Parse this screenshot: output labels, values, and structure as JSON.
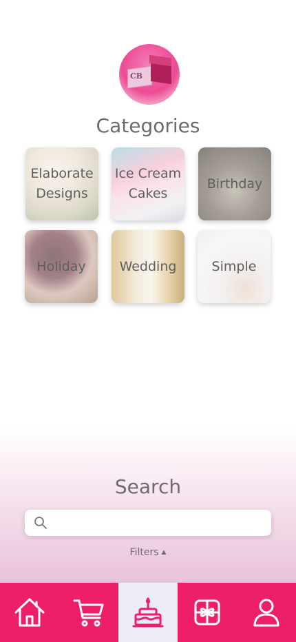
{
  "header": {
    "logo_text": "CB",
    "title": "Categories"
  },
  "categories": [
    {
      "label": "Elaborate Designs"
    },
    {
      "label": "Ice Cream Cakes"
    },
    {
      "label": "Birthday"
    },
    {
      "label": "Holiday"
    },
    {
      "label": "Wedding"
    },
    {
      "label": "Simple"
    }
  ],
  "search": {
    "title": "Search",
    "value": "",
    "placeholder": "",
    "filters_label": "Filters",
    "filters_caret": "▲"
  },
  "nav": {
    "items": [
      {
        "icon": "home-icon",
        "active": false
      },
      {
        "icon": "cart-icon",
        "active": false
      },
      {
        "icon": "cake-icon",
        "active": true
      },
      {
        "icon": "gift-icon",
        "active": false
      },
      {
        "icon": "user-icon",
        "active": false
      }
    ],
    "accent_color": "#ee1f6a",
    "active_bg": "#f0ecf7"
  }
}
